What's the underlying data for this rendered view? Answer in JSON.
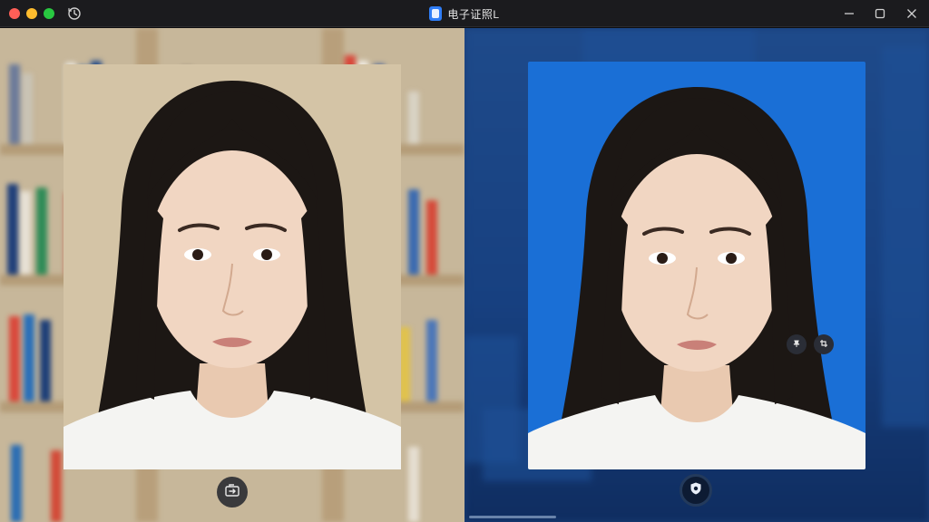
{
  "window": {
    "title": "电子证照L"
  },
  "icons": {
    "close": "traffic-close",
    "minimize": "traffic-minimize",
    "maximize": "traffic-maximize",
    "history": "history-icon",
    "app": "app-icon",
    "win_minimize": "minimize-icon",
    "win_restore": "restore-icon",
    "win_close": "close-icon",
    "replace_background": "replace-background-icon",
    "shield": "shield-icon",
    "pin": "pin-icon",
    "crop": "crop-icon"
  },
  "colors": {
    "background_blue": "#1a6fd6",
    "titlebar": "#1b1b1e",
    "traffic_red": "#ff5f57",
    "traffic_yellow": "#febc2e",
    "traffic_green": "#28c840"
  },
  "panels": {
    "left": {
      "label": "original-photo"
    },
    "right": {
      "label": "blue-background-photo"
    }
  }
}
